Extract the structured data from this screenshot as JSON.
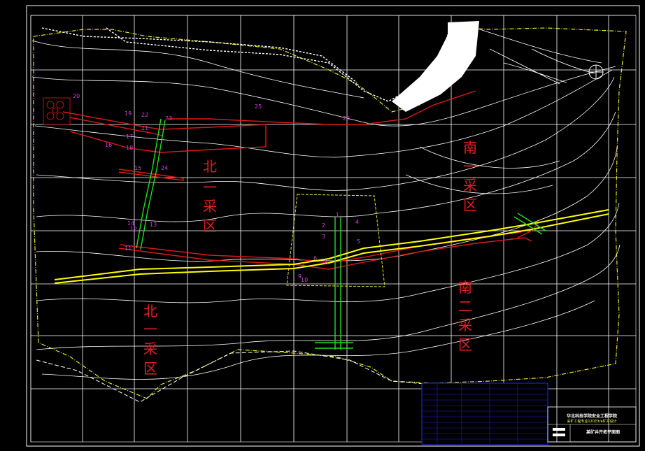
{
  "zones": {
    "north_1a": "北一采区",
    "north_1b": "北一采区",
    "south_1": "南一采区",
    "south_2": "南二采区"
  },
  "point_labels": [
    "20",
    "19",
    "22",
    "21",
    "23",
    "25",
    "26",
    "17",
    "18",
    "15",
    "24",
    "14",
    "13",
    "12",
    "11",
    "2",
    "3",
    "4",
    "1",
    "5",
    "6",
    "7",
    "8",
    "9",
    "10",
    "16"
  ],
  "title_block": {
    "school": "华北科技学院安全工程学院",
    "project": "采矿工程专业120万t/a矿井设计",
    "drawing": "某矿井开拓平面图"
  },
  "colors": {
    "background": "#000000",
    "contour": "#ffffff",
    "boundary": "#e8e820",
    "main_roadway": "#ffff00",
    "haulage": "#e01818",
    "shaft": "#20e020",
    "label_red": "#e02020",
    "label_magenta": "#d040e0",
    "title_block": "#2020d0"
  }
}
